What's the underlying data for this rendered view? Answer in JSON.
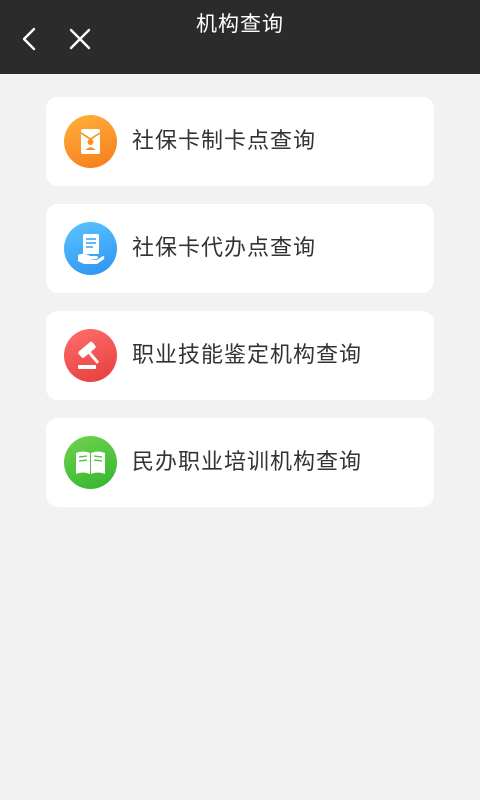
{
  "header": {
    "title": "机构查询",
    "back_icon": "chevron-left-icon",
    "close_icon": "close-icon"
  },
  "items": [
    {
      "label": "社保卡制卡点查询",
      "icon": "id-card-icon",
      "color": "#f7901e"
    },
    {
      "label": "社保卡代办点查询",
      "icon": "document-hand-icon",
      "color": "#3aa8f5"
    },
    {
      "label": "职业技能鉴定机构查询",
      "icon": "gavel-icon",
      "color": "#ef4c4a"
    },
    {
      "label": "民办职业培训机构查询",
      "icon": "open-book-icon",
      "color": "#45c038"
    }
  ]
}
